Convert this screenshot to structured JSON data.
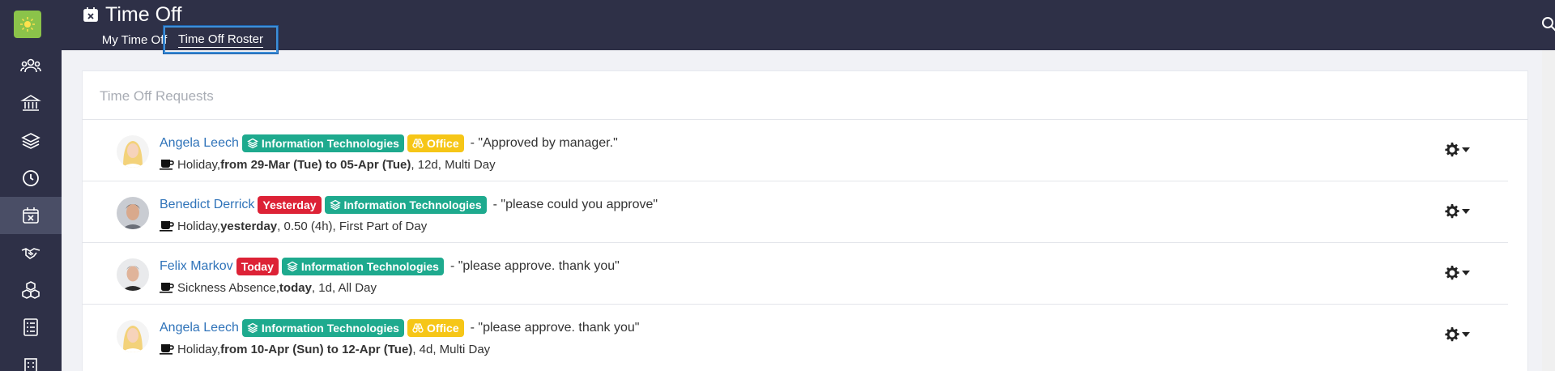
{
  "app": {
    "title": "Time Off",
    "tabs": [
      {
        "label": "My Time Off"
      },
      {
        "label": "Time Off Roster"
      }
    ]
  },
  "sidebar": {
    "items": [
      {
        "icon": "people-icon"
      },
      {
        "icon": "bank-icon"
      },
      {
        "icon": "layers-icon"
      },
      {
        "icon": "clock-icon"
      },
      {
        "icon": "calendar-x-icon"
      },
      {
        "icon": "handshake-icon"
      },
      {
        "icon": "boxes-icon"
      },
      {
        "icon": "checklist-icon"
      },
      {
        "icon": "building-icon"
      }
    ]
  },
  "section": {
    "title": "Time Off Requests"
  },
  "requests": [
    {
      "name": "Angela Leech",
      "badges": [
        "Information Technologies",
        "Office"
      ],
      "note": "- \"Approved by manager.\"",
      "type": "Holiday, ",
      "when": "from 29-Mar (Tue) to 05-Apr (Tue)",
      "detail": ", 12d, Multi Day"
    },
    {
      "name": "Benedict Derrick",
      "badges": [
        "Yesterday",
        "Information Technologies"
      ],
      "note": "- \"please could you approve\"",
      "type": "Holiday, ",
      "when": "yesterday",
      "detail": ", 0.50 (4h), First Part of Day"
    },
    {
      "name": "Felix Markov",
      "badges": [
        "Today",
        "Information Technologies"
      ],
      "note": "- \"please approve. thank you\"",
      "type": "Sickness Absence, ",
      "when": "today",
      "detail": ", 1d, All Day"
    },
    {
      "name": "Angela Leech",
      "badges": [
        "Information Technologies",
        "Office"
      ],
      "note": "- \"please approve. thank you\"",
      "type": "Holiday, ",
      "when": "from 10-Apr (Sun) to 12-Apr (Tue)",
      "detail": ", 4d, Multi Day"
    }
  ],
  "colors": {
    "nav_bg": "#2e3047",
    "department": "#1eaa8e",
    "office": "#f6c617",
    "urgent": "#dd2236",
    "link": "#2f73b9"
  }
}
